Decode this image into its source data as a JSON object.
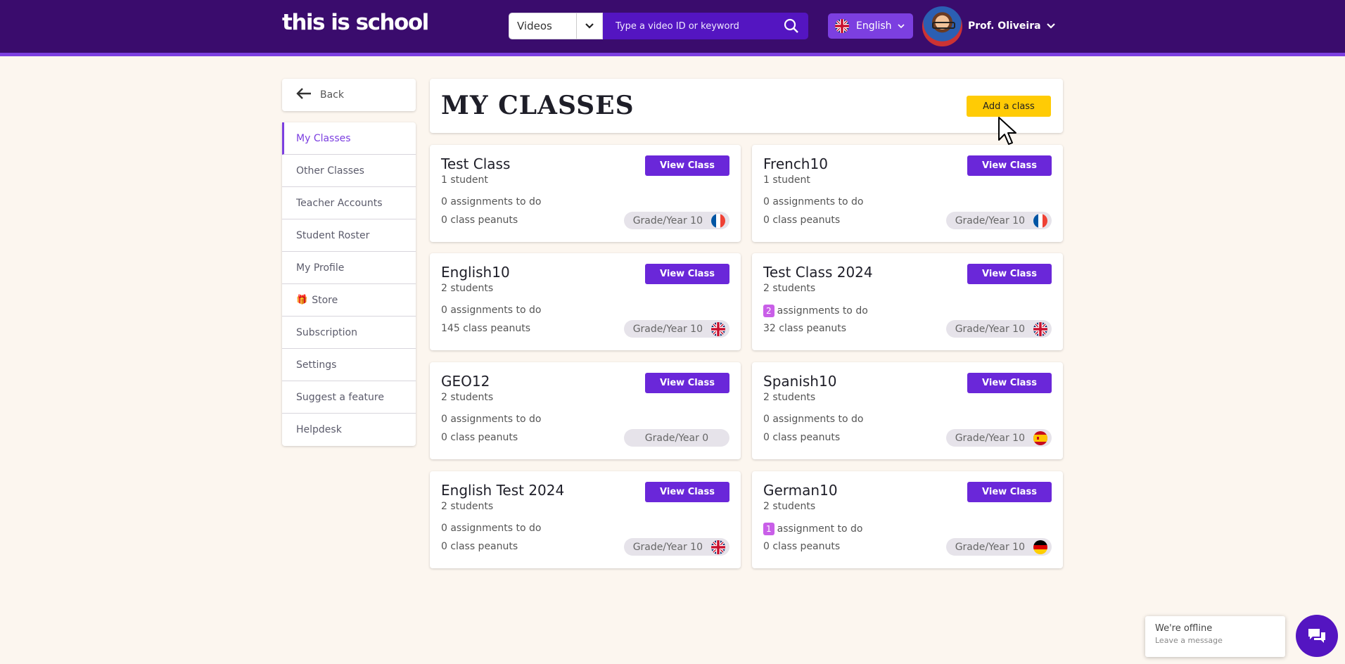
{
  "header": {
    "logo": "this is school",
    "search": {
      "type_selected": "Videos",
      "placeholder": "Type a video ID or keyword"
    },
    "language": "English",
    "user_name": "Prof. Oliveira"
  },
  "sidebar": {
    "back_label": "Back",
    "items": [
      {
        "label": "My Classes"
      },
      {
        "label": "Other Classes"
      },
      {
        "label": "Teacher Accounts"
      },
      {
        "label": "Student Roster"
      },
      {
        "label": "My Profile"
      },
      {
        "label": "Store"
      },
      {
        "label": "Subscription"
      },
      {
        "label": "Settings"
      },
      {
        "label": "Suggest a feature"
      },
      {
        "label": "Helpdesk"
      }
    ]
  },
  "main": {
    "title": "MY CLASSES",
    "add_button": "Add a class",
    "view_button": "View Class",
    "classes": [
      {
        "name": "Test Class",
        "students": "1 student",
        "assign_count": "",
        "assign_text": "0 assignments to do",
        "peanuts": "0 class peanuts",
        "grade": "Grade/Year 10",
        "flag": "fr"
      },
      {
        "name": "French10",
        "students": "1 student",
        "assign_count": "",
        "assign_text": "0 assignments to do",
        "peanuts": "0 class peanuts",
        "grade": "Grade/Year 10",
        "flag": "fr"
      },
      {
        "name": "English10",
        "students": "2 students",
        "assign_count": "",
        "assign_text": "0 assignments to do",
        "peanuts": "145 class peanuts",
        "grade": "Grade/Year 10",
        "flag": "uk"
      },
      {
        "name": "Test Class 2024",
        "students": "2 students",
        "assign_count": "2",
        "assign_text": "assignments to do",
        "peanuts": "32 class peanuts",
        "grade": "Grade/Year 10",
        "flag": "uk"
      },
      {
        "name": "GEO12",
        "students": "2 students",
        "assign_count": "",
        "assign_text": "0 assignments to do",
        "peanuts": "0 class peanuts",
        "grade": "Grade/Year 0",
        "flag": ""
      },
      {
        "name": "Spanish10",
        "students": "2 students",
        "assign_count": "",
        "assign_text": "0 assignments to do",
        "peanuts": "0 class peanuts",
        "grade": "Grade/Year 10",
        "flag": "es"
      },
      {
        "name": "English Test 2024",
        "students": "2 students",
        "assign_count": "",
        "assign_text": "0 assignments to do",
        "peanuts": "0 class peanuts",
        "grade": "Grade/Year 10",
        "flag": "uk"
      },
      {
        "name": "German10",
        "students": "2 students",
        "assign_count": "1",
        "assign_text": "assignment to do",
        "peanuts": "0 class peanuts",
        "grade": "Grade/Year 10",
        "flag": "de"
      }
    ]
  },
  "chat": {
    "title": "We're offline",
    "subtitle": "Leave a message"
  },
  "colors": {
    "brand_dark": "#3a0c6d",
    "brand_purple": "#7c3fe0",
    "button_purple": "#6a27d9",
    "accent_yellow": "#ffcb05",
    "badge_pink": "#c95fe8",
    "background": "#fcf6ef"
  },
  "icons": [
    "chevron-down-icon",
    "search-icon",
    "uk-flag-icon",
    "back-arrow-icon",
    "gift-icon",
    "france-flag-icon",
    "spain-flag-icon",
    "germany-flag-icon",
    "chat-icon",
    "cursor-icon"
  ]
}
